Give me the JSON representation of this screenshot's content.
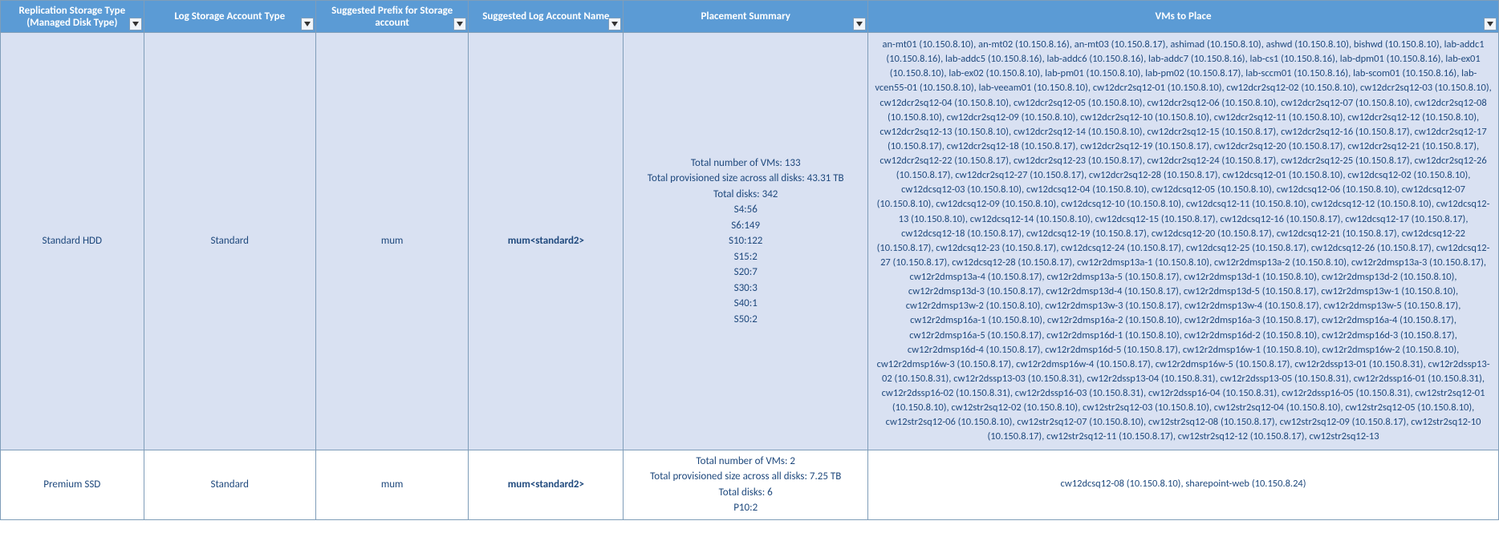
{
  "headers": {
    "col1": "Replication Storage Type (Managed Disk Type)",
    "col2": "Log Storage Account Type",
    "col3": "Suggested Prefix for Storage account",
    "col4": "Suggested Log Account  Name",
    "col5": "Placement Summary",
    "col6": "VMs to Place"
  },
  "rows": [
    {
      "replication_type": "Standard HDD",
      "log_account_type": "Standard",
      "prefix": "mum",
      "log_account_name": "mum<standard2>",
      "placement": {
        "total_vms": "Total number of VMs: 133",
        "total_size": "Total provisioned size across all disks: 43.31 TB",
        "total_disks": "Total disks: 342",
        "d1": "S4:56",
        "d2": "S6:149",
        "d3": "S10:122",
        "d4": "S15:2",
        "d5": "S20:7",
        "d6": "S30:3",
        "d7": "S40:1",
        "d8": "S50:2"
      },
      "vms": "an-mt01 (10.150.8.10), an-mt02 (10.150.8.16), an-mt03 (10.150.8.17), ashimad (10.150.8.10), ashwd (10.150.8.10), bishwd (10.150.8.10), lab-addc1 (10.150.8.16), lab-addc5 (10.150.8.16), lab-addc6 (10.150.8.16), lab-addc7 (10.150.8.16), lab-cs1 (10.150.8.16), lab-dpm01 (10.150.8.16), lab-ex01 (10.150.8.10), lab-ex02 (10.150.8.10), lab-pm01 (10.150.8.10), lab-pm02 (10.150.8.17), lab-sccm01 (10.150.8.16), lab-scom01 (10.150.8.16), lab-vcen55-01 (10.150.8.10), lab-veeam01 (10.150.8.10), cw12dcr2sq12-01 (10.150.8.10), cw12dcr2sq12-02 (10.150.8.10), cw12dcr2sq12-03 (10.150.8.10), cw12dcr2sq12-04 (10.150.8.10), cw12dcr2sq12-05 (10.150.8.10), cw12dcr2sq12-06 (10.150.8.10), cw12dcr2sq12-07 (10.150.8.10), cw12dcr2sq12-08 (10.150.8.10), cw12dcr2sq12-09 (10.150.8.10), cw12dcr2sq12-10 (10.150.8.10), cw12dcr2sq12-11 (10.150.8.10), cw12dcr2sq12-12 (10.150.8.10), cw12dcr2sq12-13 (10.150.8.10), cw12dcr2sq12-14 (10.150.8.10), cw12dcr2sq12-15 (10.150.8.17), cw12dcr2sq12-16 (10.150.8.17), cw12dcr2sq12-17 (10.150.8.17), cw12dcr2sq12-18 (10.150.8.17), cw12dcr2sq12-19 (10.150.8.17), cw12dcr2sq12-20 (10.150.8.17), cw12dcr2sq12-21 (10.150.8.17), cw12dcr2sq12-22 (10.150.8.17), cw12dcr2sq12-23 (10.150.8.17), cw12dcr2sq12-24 (10.150.8.17), cw12dcr2sq12-25 (10.150.8.17), cw12dcr2sq12-26 (10.150.8.17), cw12dcr2sq12-27 (10.150.8.17), cw12dcr2sq12-28 (10.150.8.17), cw12dcsq12-01 (10.150.8.10), cw12dcsq12-02 (10.150.8.10), cw12dcsq12-03 (10.150.8.10), cw12dcsq12-04 (10.150.8.10), cw12dcsq12-05 (10.150.8.10), cw12dcsq12-06 (10.150.8.10), cw12dcsq12-07 (10.150.8.10), cw12dcsq12-09 (10.150.8.10), cw12dcsq12-10 (10.150.8.10), cw12dcsq12-11 (10.150.8.10), cw12dcsq12-12 (10.150.8.10), cw12dcsq12-13 (10.150.8.10), cw12dcsq12-14 (10.150.8.10), cw12dcsq12-15 (10.150.8.17), cw12dcsq12-16 (10.150.8.17), cw12dcsq12-17 (10.150.8.17), cw12dcsq12-18 (10.150.8.17), cw12dcsq12-19 (10.150.8.17), cw12dcsq12-20 (10.150.8.17), cw12dcsq12-21 (10.150.8.17), cw12dcsq12-22 (10.150.8.17), cw12dcsq12-23 (10.150.8.17), cw12dcsq12-24 (10.150.8.17), cw12dcsq12-25 (10.150.8.17), cw12dcsq12-26 (10.150.8.17), cw12dcsq12-27 (10.150.8.17), cw12dcsq12-28 (10.150.8.17), cw12r2dmsp13a-1 (10.150.8.10), cw12r2dmsp13a-2 (10.150.8.10), cw12r2dmsp13a-3 (10.150.8.17), cw12r2dmsp13a-4 (10.150.8.17), cw12r2dmsp13a-5 (10.150.8.17), cw12r2dmsp13d-1 (10.150.8.10), cw12r2dmsp13d-2 (10.150.8.10), cw12r2dmsp13d-3 (10.150.8.17), cw12r2dmsp13d-4 (10.150.8.17), cw12r2dmsp13d-5 (10.150.8.17), cw12r2dmsp13w-1 (10.150.8.10), cw12r2dmsp13w-2 (10.150.8.10), cw12r2dmsp13w-3 (10.150.8.17), cw12r2dmsp13w-4 (10.150.8.17), cw12r2dmsp13w-5 (10.150.8.17), cw12r2dmsp16a-1 (10.150.8.10), cw12r2dmsp16a-2 (10.150.8.10), cw12r2dmsp16a-3 (10.150.8.17), cw12r2dmsp16a-4 (10.150.8.17), cw12r2dmsp16a-5 (10.150.8.17), cw12r2dmsp16d-1 (10.150.8.10), cw12r2dmsp16d-2 (10.150.8.10), cw12r2dmsp16d-3 (10.150.8.17), cw12r2dmsp16d-4 (10.150.8.17), cw12r2dmsp16d-5 (10.150.8.17), cw12r2dmsp16w-1 (10.150.8.10), cw12r2dmsp16w-2 (10.150.8.10), cw12r2dmsp16w-3 (10.150.8.17), cw12r2dmsp16w-4 (10.150.8.17), cw12r2dmsp16w-5 (10.150.8.17), cw12r2dssp13-01 (10.150.8.31), cw12r2dssp13-02 (10.150.8.31), cw12r2dssp13-03 (10.150.8.31), cw12r2dssp13-04 (10.150.8.31), cw12r2dssp13-05 (10.150.8.31), cw12r2dssp16-01 (10.150.8.31), cw12r2dssp16-02 (10.150.8.31), cw12r2dssp16-03 (10.150.8.31), cw12r2dssp16-04 (10.150.8.31), cw12r2dssp16-05 (10.150.8.31), cw12str2sq12-01 (10.150.8.10), cw12str2sq12-02 (10.150.8.10), cw12str2sq12-03 (10.150.8.10), cw12str2sq12-04 (10.150.8.10), cw12str2sq12-05 (10.150.8.10), cw12str2sq12-06 (10.150.8.10), cw12str2sq12-07 (10.150.8.10), cw12str2sq12-08 (10.150.8.17), cw12str2sq12-09 (10.150.8.17), cw12str2sq12-10 (10.150.8.17), cw12str2sq12-11 (10.150.8.17), cw12str2sq12-12 (10.150.8.17), cw12str2sq12-13"
    },
    {
      "replication_type": "Premium SSD",
      "log_account_type": "Standard",
      "prefix": "mum",
      "log_account_name": "mum<standard2>",
      "placement": {
        "total_vms": "Total number of VMs: 2",
        "total_size": "Total provisioned size across all disks: 7.25 TB",
        "total_disks": "Total disks: 6",
        "d1": "P10:2"
      },
      "vms": "cw12dcsq12-08 (10.150.8.10), sharepoint-web (10.150.8.24)"
    }
  ]
}
